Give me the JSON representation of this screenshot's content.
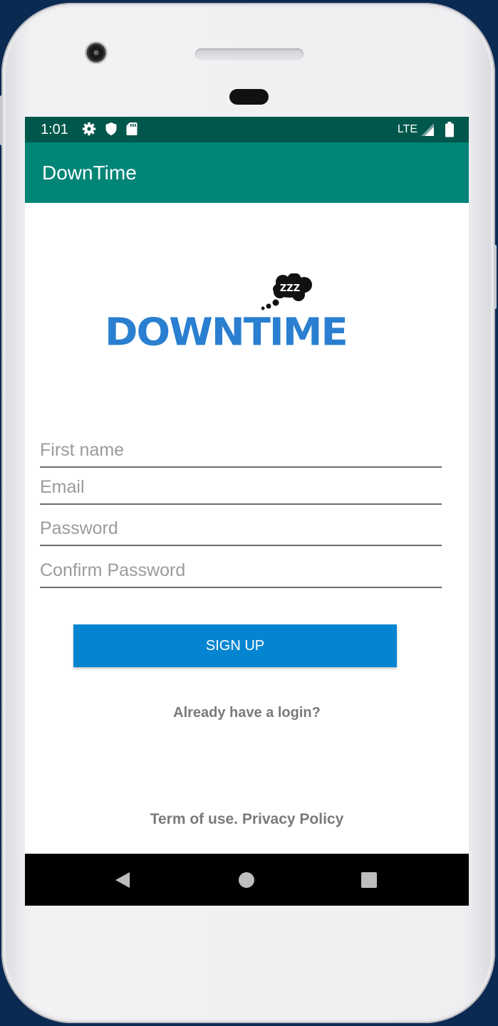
{
  "status_bar": {
    "time": "1:01",
    "network": "LTE"
  },
  "app_bar": {
    "title": "DownTime"
  },
  "logo": {
    "wordmark": "DOWNTIME",
    "cloud_text": "ZZZ"
  },
  "form": {
    "first_name": {
      "placeholder": "First name",
      "value": ""
    },
    "email": {
      "placeholder": "Email",
      "value": ""
    },
    "password": {
      "placeholder": "Password",
      "value": ""
    },
    "confirm_password": {
      "placeholder": "Confirm Password",
      "value": ""
    },
    "signup_label": "SIGN UP"
  },
  "links": {
    "login": "Already have a login?",
    "terms": "Term of use. Privacy Policy"
  },
  "icons": [
    "gear-icon",
    "shield-icon",
    "sd-card-icon",
    "signal-icon",
    "battery-icon",
    "back-icon",
    "home-icon",
    "recent-apps-icon"
  ],
  "colors": {
    "status_bar": "#00574b",
    "app_bar": "#008577",
    "button": "#0585d1",
    "logo": "#2a7fd0"
  }
}
